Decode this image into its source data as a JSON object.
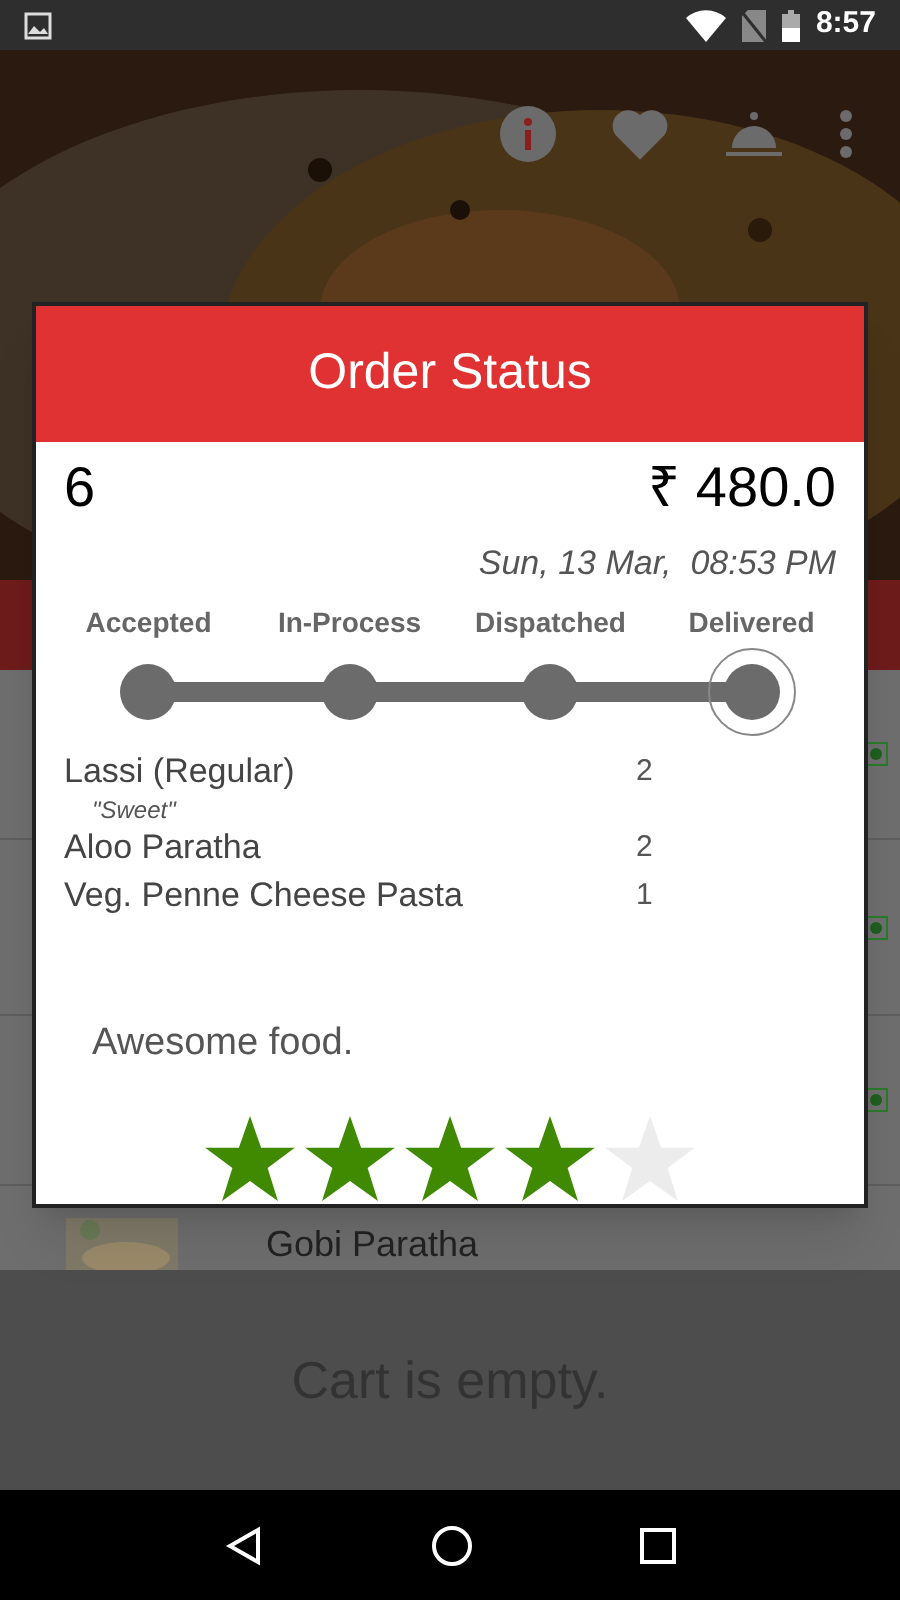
{
  "status_bar": {
    "time": "8:57"
  },
  "order_dialog": {
    "title": "Order Status",
    "order_number": "6",
    "total": "₹ 480.0",
    "date": "Sun, 13 Mar,  08:53 PM",
    "steps": [
      {
        "label": "Accepted",
        "selected": false
      },
      {
        "label": "In-Process",
        "selected": false
      },
      {
        "label": "Dispatched",
        "selected": false
      },
      {
        "label": "Delivered",
        "selected": true
      }
    ],
    "items": [
      {
        "name": "Lassi (Regular)",
        "note": "\"Sweet\"",
        "quantity": "2"
      },
      {
        "name": "Aloo Paratha",
        "quantity": "2"
      },
      {
        "name": "Veg. Penne Cheese Pasta",
        "quantity": "1"
      }
    ],
    "comment": "Awesome food.",
    "stars": 4
  },
  "menu_item": {
    "name": "Gobi Paratha"
  },
  "cart": {
    "message": "Cart is empty."
  }
}
